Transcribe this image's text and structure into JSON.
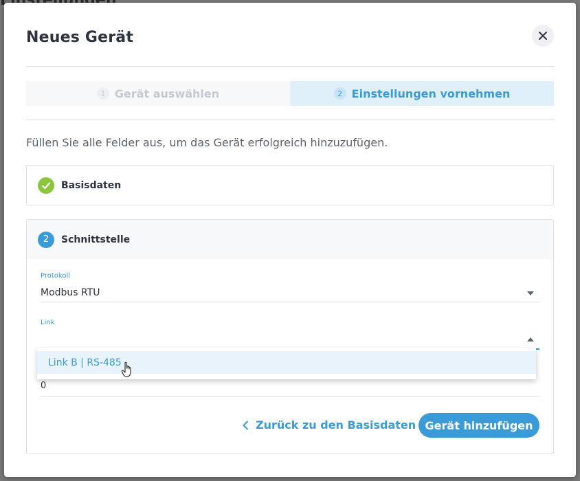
{
  "background": {
    "title": "Einstellungen"
  },
  "modal": {
    "title": "Neues Gerät",
    "close_icon": "close-icon"
  },
  "stepper": {
    "steps": [
      {
        "number": "1",
        "label": "Gerät auswählen",
        "state": "done"
      },
      {
        "number": "2",
        "label": "Einstellungen vornehmen",
        "state": "active"
      }
    ]
  },
  "instruction": "Füllen Sie alle Felder aus, um das Gerät erfolgreich hinzuzufügen.",
  "sections": {
    "basis": {
      "label": "Basisdaten",
      "icon": "check-icon",
      "status_color": "#8cc63f"
    },
    "schnitt": {
      "number": "2",
      "label": "Schnittstelle",
      "accent": "#3a9bd6"
    }
  },
  "fields": {
    "protokoll": {
      "label": "Protokoll",
      "value": "Modbus RTU"
    },
    "link": {
      "label": "Link",
      "value": ""
    },
    "hidden_field": {
      "value": "0"
    }
  },
  "dropdown": {
    "options": [
      "Link B | RS-485"
    ]
  },
  "actions": {
    "back_label": "Zurück zu den Basisdaten",
    "submit_label": "Gerät hinzufügen"
  }
}
